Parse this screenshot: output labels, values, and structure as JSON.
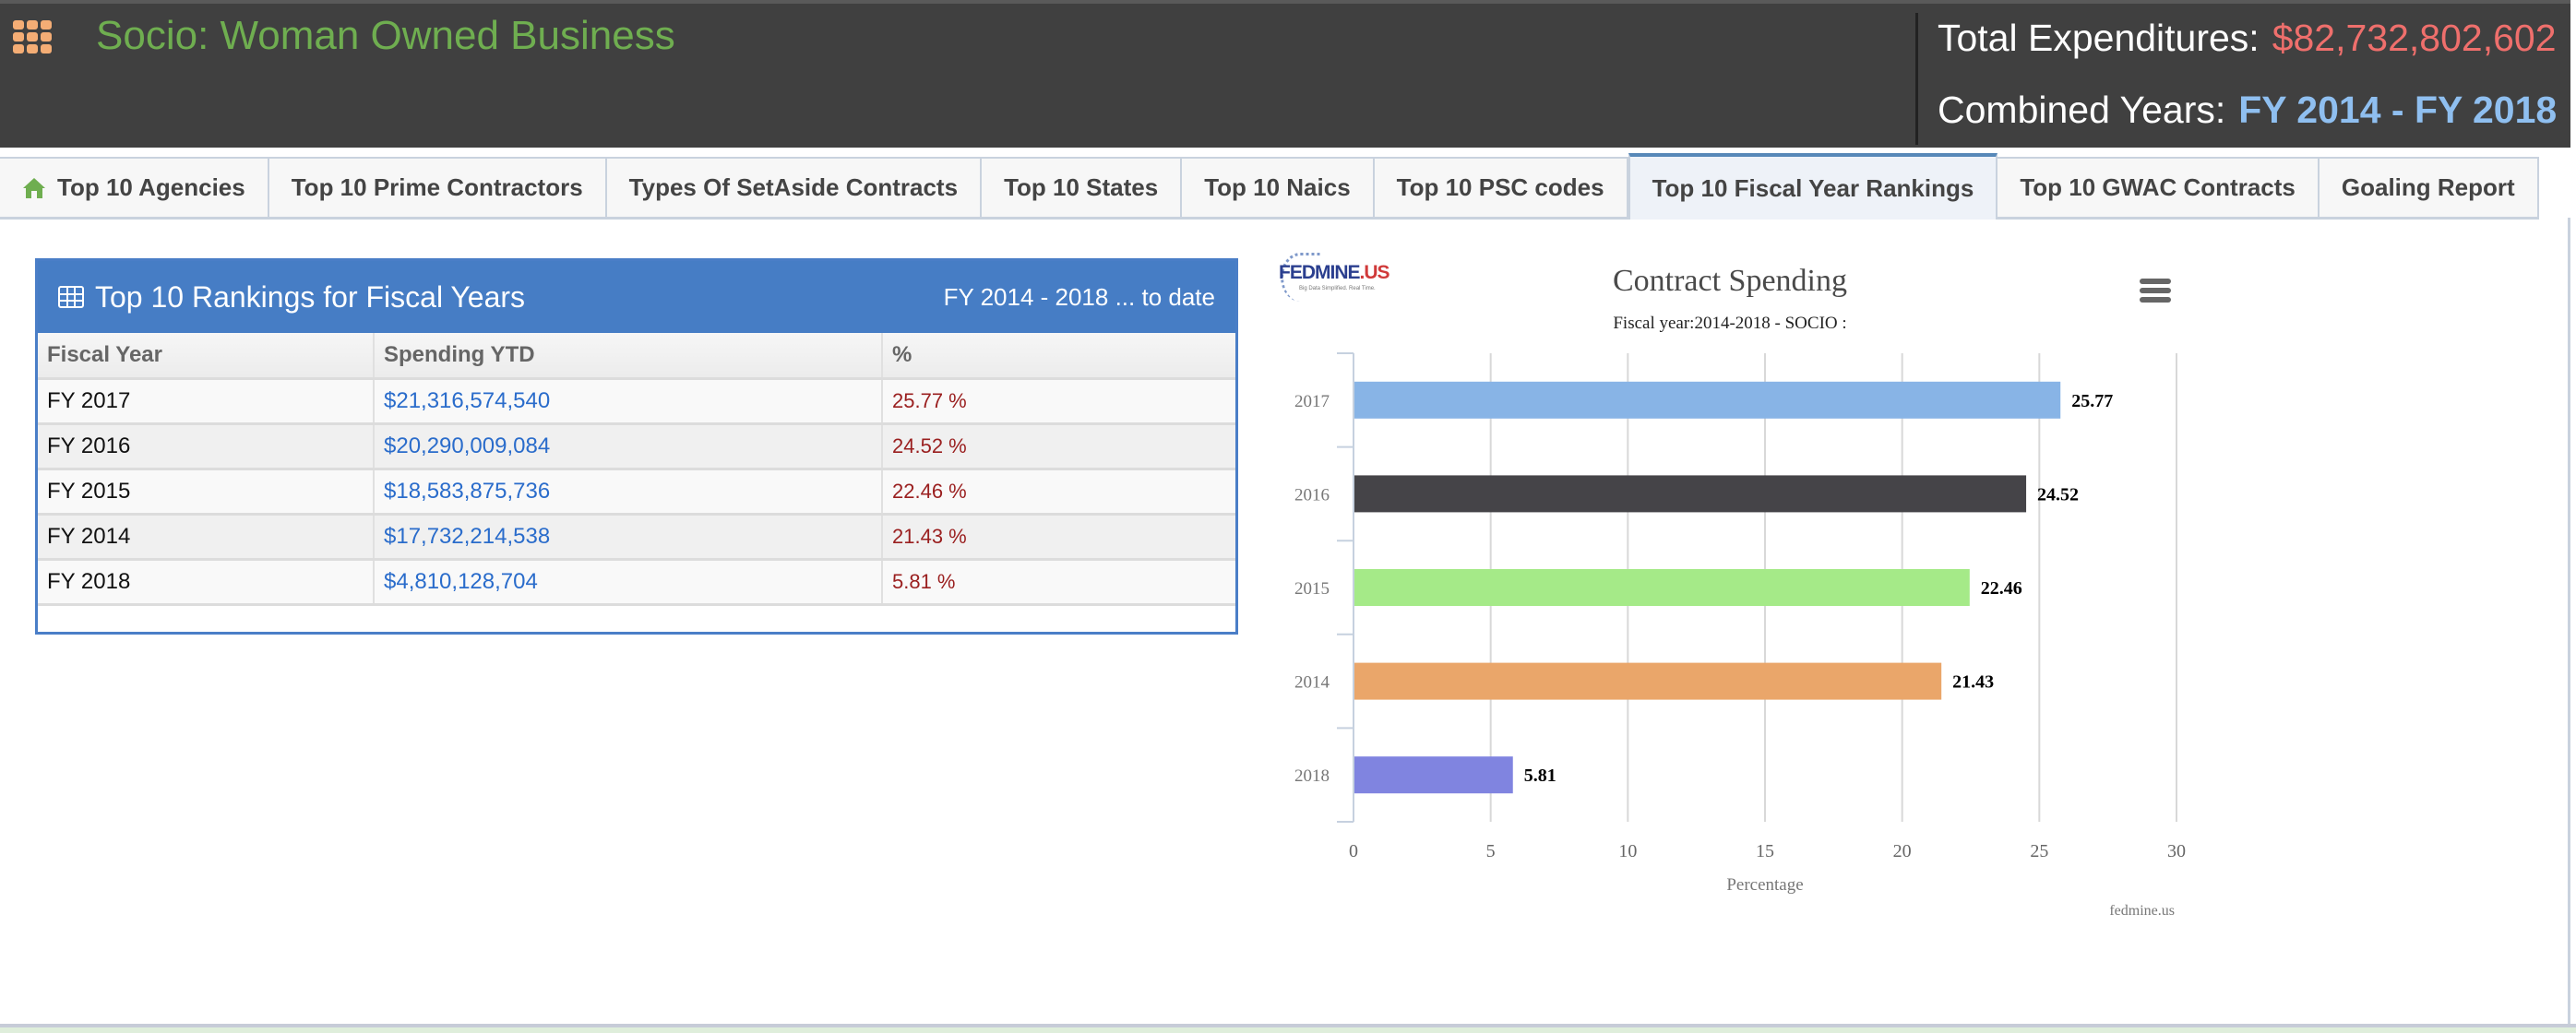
{
  "header": {
    "title": "Socio: Woman Owned Business",
    "apps_icon": "apps-grid-icon",
    "total_label": "Total Expenditures:",
    "total_value": "$82,732,802,602",
    "years_label": "Combined Years:",
    "years_value": "FY 2014 - FY 2018",
    "colors": {
      "title": "#6fae50",
      "total_value": "#ef6f6c",
      "years_value": "#8fbff0",
      "background": "#404040"
    }
  },
  "tabs": [
    {
      "label": "Top 10 Agencies",
      "icon": "home-icon",
      "active": false
    },
    {
      "label": "Top 10 Prime Contractors",
      "active": false
    },
    {
      "label": "Types Of SetAside Contracts",
      "active": false
    },
    {
      "label": "Top 10 States",
      "active": false
    },
    {
      "label": "Top 10 Naics",
      "active": false
    },
    {
      "label": "Top 10 PSC codes",
      "active": false
    },
    {
      "label": "Top 10 Fiscal Year Rankings",
      "active": true
    },
    {
      "label": "Top 10 GWAC Contracts",
      "active": false
    },
    {
      "label": "Goaling Report",
      "active": false
    }
  ],
  "rankings": {
    "title": "Top 10 Rankings for Fiscal Years",
    "range": "FY 2014 - 2018 ... to date",
    "columns": [
      "Fiscal Year",
      "Spending YTD",
      "%"
    ],
    "rows": [
      {
        "year": "FY 2017",
        "spending": "$21,316,574,540",
        "pct": "25.77 %"
      },
      {
        "year": "FY 2016",
        "spending": "$20,290,009,084",
        "pct": "24.52 %"
      },
      {
        "year": "FY 2015",
        "spending": "$18,583,875,736",
        "pct": "22.46 %"
      },
      {
        "year": "FY 2014",
        "spending": "$17,732,214,538",
        "pct": "21.43 %"
      },
      {
        "year": "FY 2018",
        "spending": "$4,810,128,704",
        "pct": "5.81 %"
      }
    ]
  },
  "chart_logo": {
    "name": "FEDMINE",
    "suffix": ".US",
    "tagline": "Big Data Simplified. Real Time."
  },
  "chart_data": {
    "type": "bar",
    "orientation": "horizontal",
    "title": "Contract Spending",
    "subtitle": "Fiscal year:2014-2018 - SOCIO :",
    "categories": [
      "2017",
      "2016",
      "2015",
      "2014",
      "2018"
    ],
    "values": [
      25.77,
      24.52,
      22.46,
      21.43,
      5.81
    ],
    "data_labels": [
      "25.77",
      "24.52",
      "22.46",
      "21.43",
      "5.81"
    ],
    "colors": [
      "#88b4e6",
      "#454448",
      "#a5ea88",
      "#eaa66a",
      "#8084e0"
    ],
    "xlabel": "Percentage",
    "ylabel": "",
    "xlim": [
      0,
      30
    ],
    "xticks": [
      0,
      5,
      10,
      15,
      20,
      25,
      30
    ],
    "grid": true,
    "legend": "none",
    "credit": "fedmine.us",
    "menu_icon": "hamburger-menu-icon"
  }
}
